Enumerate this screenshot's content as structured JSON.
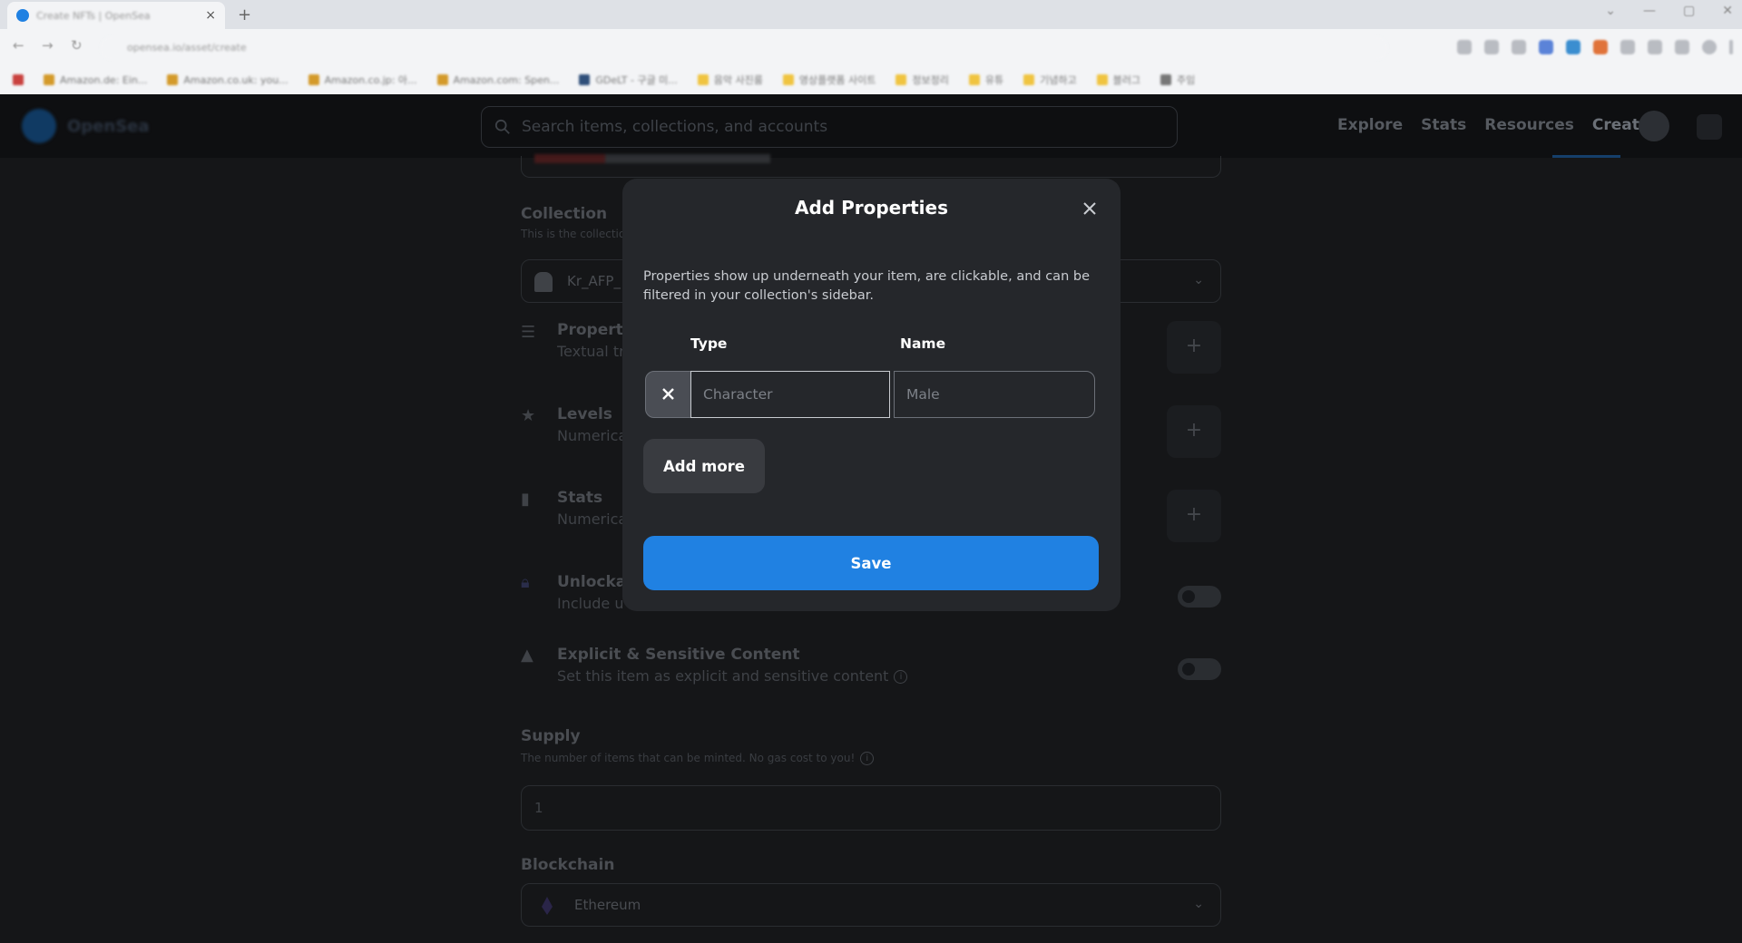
{
  "browser": {
    "tab_title": "Create NFTs | OpenSea",
    "tab_close": "×",
    "new_tab": "+",
    "url": "opensea.io/asset/create",
    "bookmarks": [
      "Amazon.de: Ein...",
      "Amazon.co.uk: you...",
      "Amazon.co.jp: 아...",
      "Amazon.com: Spen...",
      "GDeLT - 구글 미...",
      "음악 사진룸",
      "영상플랫폼 사이트",
      "정보정리",
      "유튜",
      "기념하고",
      "블러그",
      "주임"
    ]
  },
  "header": {
    "logo_text": "OpenSea",
    "search_placeholder": "Search items, collections, and accounts",
    "nav": [
      "Explore",
      "Stats",
      "Resources",
      "Create"
    ],
    "active_nav": "Create"
  },
  "form": {
    "collection_title": "Collection",
    "collection_sub": "This is the collection where your item will appear.",
    "collection_value": "Kr_AFP_",
    "properties_title": "Properties",
    "properties_sub": "Textual traits that show up as rectangles",
    "levels_title": "Levels",
    "levels_sub": "Numerical traits that show as a progress bar",
    "stats_title": "Stats",
    "stats_sub": "Numerical traits that just show as numbers",
    "unlockable_title": "Unlockable Content",
    "unlockable_sub": "Include unlockable content that can only be revealed by the owner of the item.",
    "explicit_title": "Explicit & Sensitive Content",
    "explicit_sub": "Set this item as explicit and sensitive content",
    "supply_title": "Supply",
    "supply_sub": "The number of items that can be minted. No gas cost to you!",
    "supply_value": "1",
    "blockchain_title": "Blockchain",
    "blockchain_value": "Ethereum",
    "plus": "+",
    "chevron": "⌄",
    "info": "i"
  },
  "modal": {
    "title": "Add Properties",
    "description": "Properties show up underneath your item, are clickable, and can be filtered in your collection's sidebar.",
    "col_type": "Type",
    "col_name": "Name",
    "type_placeholder": "Character",
    "name_placeholder": "Male",
    "add_more_label": "Add more",
    "save_label": "Save"
  },
  "colors": {
    "accent": "#2081e2",
    "modal_bg": "#25272b",
    "overlay_bg": "#151618"
  }
}
